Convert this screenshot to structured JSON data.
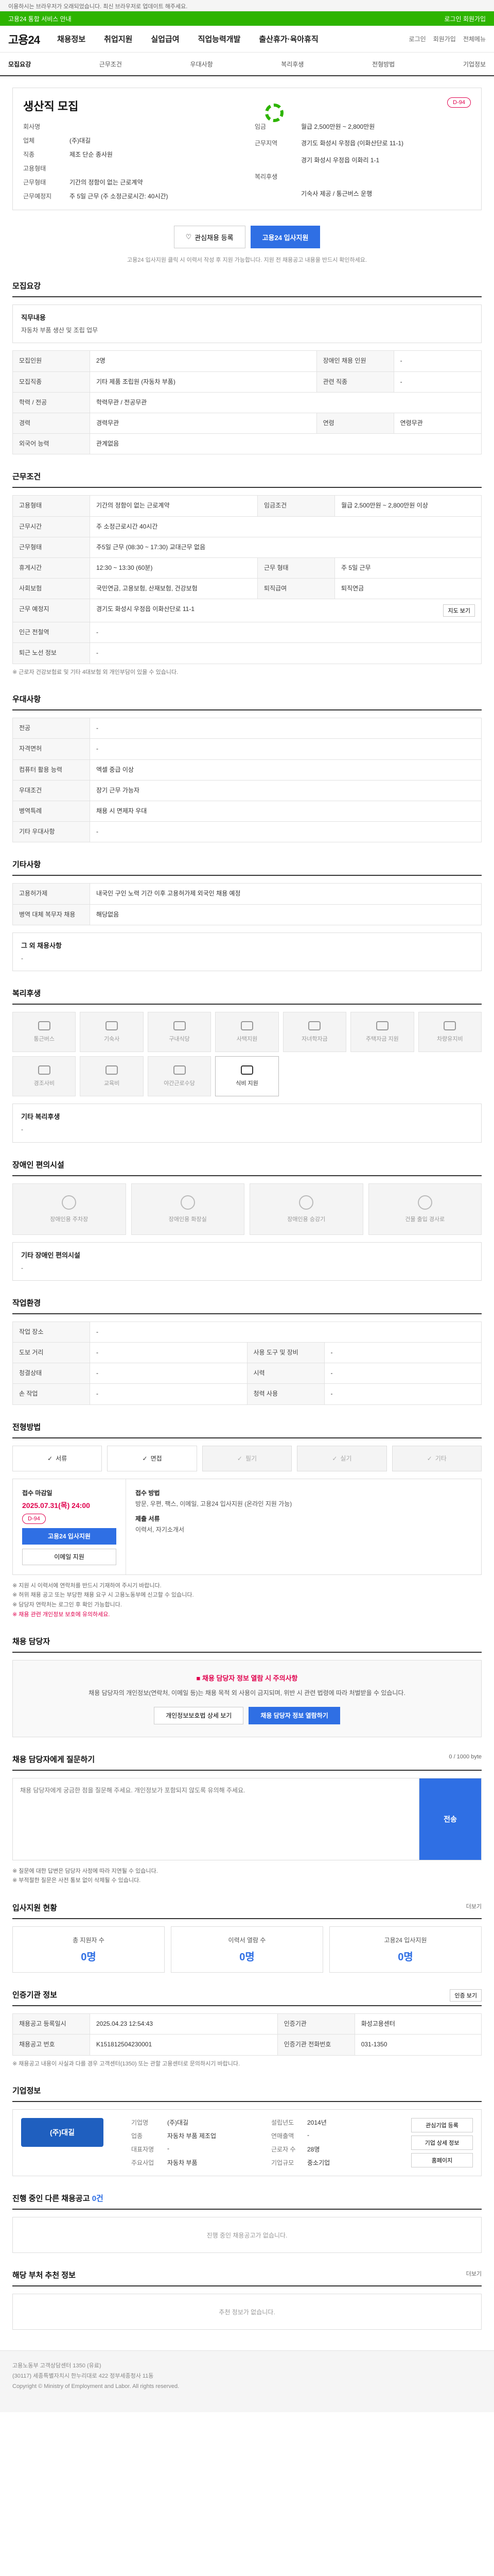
{
  "topbar": {
    "text": "이용하시는 브라우저가 오래되었습니다. 최신 브라우저로 업데이트 해주세요."
  },
  "accent": {
    "left": "고용24 통합 서비스 안내",
    "right": "로그인 회원가입"
  },
  "header": {
    "logo": "고용24",
    "nav": [
      "채용정보",
      "취업지원",
      "실업급여",
      "직업능력개발",
      "출산휴가·육아휴직"
    ],
    "right": [
      "로그인",
      "회원가입",
      "전체메뉴"
    ]
  },
  "tabs": [
    "모집요강",
    "근무조건",
    "우대사항",
    "복리후생",
    "전형방법",
    "기업정보"
  ],
  "summary": {
    "title": "생산직 모집",
    "dday": "D-94",
    "left": [
      {
        "k": "회사명",
        "v": ""
      },
      {
        "k": "업체",
        "v": "(주)대길"
      },
      {
        "k": "직종",
        "v": "제조 단순 종사원"
      },
      {
        "k": "고용형태",
        "v": ""
      },
      {
        "k": "근무형태",
        "v": "기간의 정함이 없는 근로계약"
      },
      {
        "k": "근무예정지",
        "v": "주 5일 근무 (주 소정근로시간: 40시간)"
      }
    ],
    "right": [
      {
        "k": "임금",
        "v": "월급 2,500만원 ~ 2,800만원"
      },
      {
        "k": "근무지역",
        "v": "경기도 화성시 우정읍 (이화산단로 11-1)"
      },
      {
        "k": "",
        "v": "경기 화성시 우정읍 이화리 1-1"
      },
      {
        "k": "복리후생",
        "v": ""
      },
      {
        "k": "",
        "v": "기숙사 제공 / 통근버스 운행"
      }
    ],
    "btn_scrap": "관심채용 등록",
    "btn_apply": "고용24 입사지원",
    "note": "고용24 입사지원 클릭 시 이력서 작성 후 지원 가능합니다. 지원 전 채용공고 내용을 반드시 확인하세요."
  },
  "s1": {
    "title": "모집요강",
    "job_label": "직무내용",
    "job_text": "자동차 부품 생산 및 조립 업무",
    "rows": [
      {
        "k": "모집인원",
        "v": "2명",
        "k2": "장애인 채용 인원",
        "v2": "-"
      },
      {
        "k": "모집직종",
        "v": "기타 제품 조립원 (자동차 부품)",
        "k2": "관련 직종",
        "v2": "-"
      },
      {
        "k": "학력 / 전공",
        "v": "학력무관 / 전공무관",
        "k2": "",
        "v2": ""
      },
      {
        "k": "경력",
        "v": "경력무관",
        "k2": "연령",
        "v2": "연령무관"
      },
      {
        "k": "외국어 능력",
        "v": "관계없음",
        "k2": "",
        "v2": ""
      }
    ]
  },
  "s2": {
    "title": "근무조건",
    "rows": [
      {
        "k": "고용형태",
        "v": "기간의 정함이 없는 근로계약",
        "k2": "임금조건",
        "v2": "월급 2,500만원 ~ 2,800만원 이상"
      },
      {
        "k": "근무시간",
        "v": "주 소정근로시간 40시간",
        "k2": "",
        "v2": ""
      },
      {
        "k": "근무형태",
        "v": "주5일 근무 (08:30 ~ 17:30) 교대근무 없음",
        "k2": "",
        "v2": ""
      },
      {
        "k": "휴게시간",
        "v": "12:30 ~ 13:30 (60분)",
        "k2": "근무 형태",
        "v2": "주 5일 근무"
      },
      {
        "k": "사회보험",
        "v": "국민연금, 고용보험, 산재보험, 건강보험",
        "k2": "퇴직급여",
        "v2": "퇴직연금"
      },
      {
        "k": "근무 예정지",
        "v": "경기도 화성시 우정읍 이화산단로 11-1",
        "k2": "",
        "v2": ""
      },
      {
        "k": "인근 전철역",
        "v": "-",
        "k2": "",
        "v2": ""
      },
      {
        "k": "퇴근 노선 정보",
        "v": "-",
        "k2": "",
        "v2": ""
      }
    ],
    "map_btn": "지도 보기",
    "note": "※ 근로자 건강보험료 및 기타 4대보험 외 개인부담이 있을 수 있습니다."
  },
  "s3": {
    "title": "우대사항",
    "rows": [
      {
        "k": "전공",
        "v": "-"
      },
      {
        "k": "자격면허",
        "v": "-"
      },
      {
        "k": "컴퓨터 활용 능력",
        "v": "엑셀 중급 이상"
      },
      {
        "k": "우대조건",
        "v": "장기 근무 가능자"
      },
      {
        "k": "병역특례",
        "v": "채용 시 면제자 우대"
      },
      {
        "k": "기타 우대사항",
        "v": "-"
      }
    ]
  },
  "s4": {
    "title": "기타사항",
    "rows": [
      {
        "k": "고용허가제",
        "v": "내국인 구인 노력 기간 이후 고용허가제 외국인 채용 예정"
      },
      {
        "k": "병역 대체 복무자 채용",
        "v": "해당없음"
      }
    ],
    "etc_label": "그 외 채용사항",
    "etc_text": "-"
  },
  "s5": {
    "title": "복리후생",
    "items": [
      {
        "label": "통근버스",
        "on": false
      },
      {
        "label": "기숙사",
        "on": false
      },
      {
        "label": "구내식당",
        "on": false
      },
      {
        "label": "사택지원",
        "on": false
      },
      {
        "label": "자녀학자금",
        "on": false
      },
      {
        "label": "주택자금 지원",
        "on": false
      },
      {
        "label": "차량유지비",
        "on": false
      },
      {
        "label": "경조사비",
        "on": false
      },
      {
        "label": "교육비",
        "on": false
      },
      {
        "label": "야간근로수당",
        "on": false
      },
      {
        "label": "식비 지원",
        "on": true
      }
    ],
    "etc_label": "기타 복리후생",
    "etc_text": "-"
  },
  "s6": {
    "title": "장애인 편의시설",
    "items": [
      "장애인용 주차장",
      "장애인용 화장실",
      "장애인용 승강기",
      "건물 출입 경사로"
    ],
    "etc_label": "기타 장애인 편의시설",
    "etc_text": "-"
  },
  "s7": {
    "title": "작업환경",
    "rows": [
      {
        "k": "작업 장소",
        "v": "-",
        "k2": "",
        "v2": ""
      },
      {
        "k": "도보 거리",
        "v": "-",
        "k2": "사용 도구 및 장비",
        "v2": "-"
      },
      {
        "k": "청결상태",
        "v": "-",
        "k2": "시력",
        "v2": "-"
      },
      {
        "k": "손 작업",
        "v": "-",
        "k2": "청력 사용",
        "v2": "-"
      }
    ]
  },
  "s8": {
    "title": "전형방법",
    "methods": [
      {
        "label": "서류",
        "on": true
      },
      {
        "label": "면접",
        "on": true
      },
      {
        "label": "필기",
        "on": false
      },
      {
        "label": "실기",
        "on": false
      },
      {
        "label": "기타",
        "on": false
      }
    ],
    "deadline_label": "접수 마감일",
    "deadline": "2025.07.31(목) 24:00",
    "dday": "D-94",
    "apply_btn": "고용24 입사지원",
    "email_btn": "이메일 지원",
    "method_k": "접수 방법",
    "method_v": "방문, 우편, 팩스, 이메일, 고용24 입사지원 (온라인 지원 가능)",
    "doc_k": "제출 서류",
    "doc_v": "이력서, 자기소개서",
    "notes": [
      "※ 지원 시 이력서에 연락처를 반드시 기재하여 주시기 바랍니다.",
      "※ 허위 채용 공고 또는 부당한 채용 요구 시 고용노동부에 신고할 수 있습니다.",
      "※ 담당자 연락처는 로그인 후 확인 가능합니다."
    ],
    "red_note": "※ 채용 관련 개인정보 보호에 유의하세요."
  },
  "s9": {
    "title": "채용 담당자",
    "warn": "채용 담당자 정보 열람 시 주의사항",
    "text": "채용 담당자의 개인정보(연락처, 이메일 등)는 채용 목적 외 사용이 금지되며, 위반 시 관련 법령에 따라 처벌받을 수 있습니다.",
    "btn1": "개인정보보호법 상세 보기",
    "btn2": "채용 담당자 정보 열람하기"
  },
  "s10": {
    "title": "채용 담당자에게 질문하기",
    "counter": "0 / 1000 byte",
    "placeholder": "채용 담당자에게 궁금한 점을 질문해 주세요. 개인정보가 포함되지 않도록 유의해 주세요.",
    "submit": "전송",
    "notes": [
      "※ 질문에 대한 답변은 담당자 사정에 따라 지연될 수 있습니다.",
      "※ 부적절한 질문은 사전 통보 없이 삭제될 수 있습니다."
    ]
  },
  "s11": {
    "title": "입사지원 현황",
    "more": "더보기",
    "stats": [
      {
        "label": "총 지원자 수",
        "num": "0명"
      },
      {
        "label": "이력서 열람 수",
        "num": "0명"
      },
      {
        "label": "고용24 입사지원",
        "num": "0명"
      }
    ]
  },
  "s12": {
    "title": "인증기관 정보",
    "btn": "인증 보기",
    "rows": [
      {
        "k": "채용공고 등록일시",
        "v": "2025.04.23 12:54:43",
        "k2": "인증기관",
        "v2": "화성고용센터"
      },
      {
        "k": "채용공고 번호",
        "v": "K151812504230001",
        "k2": "인증기관 전화번호",
        "v2": "031-1350"
      }
    ],
    "note": "※ 채용공고 내용이 사실과 다를 경우 고객센터(1350) 또는 관할 고용센터로 문의하시기 바랍니다."
  },
  "s13": {
    "title": "기업정보",
    "logo": "(주)대길",
    "kv1": [
      {
        "k": "기업명",
        "v": "(주)대길"
      },
      {
        "k": "업종",
        "v": "자동차 부품 제조업"
      },
      {
        "k": "대표자명",
        "v": "-"
      },
      {
        "k": "주요사업",
        "v": "자동차 부품"
      }
    ],
    "kv2": [
      {
        "k": "설립년도",
        "v": "2014년"
      },
      {
        "k": "연매출액",
        "v": "-"
      },
      {
        "k": "근로자 수",
        "v": "28명"
      },
      {
        "k": "기업규모",
        "v": "중소기업"
      }
    ],
    "btns": [
      "관심기업 등록",
      "기업 상세 정보",
      "홈페이지"
    ]
  },
  "s14": {
    "title": "진행 중인 다른 채용공고",
    "count": "0건",
    "empty": "진행 중인 채용공고가 없습니다."
  },
  "s15": {
    "title": "해당 부처 추천 정보",
    "more": "더보기",
    "empty": "추천 정보가 없습니다."
  },
  "footer": {
    "line1": "고용노동부 고객상담센터 1350 (유료)",
    "line2": "(30117) 세종특별자치시 한누리대로 422 정부세종청사 11동",
    "line3": "Copyright © Ministry of Employment and Labor. All rights reserved."
  }
}
